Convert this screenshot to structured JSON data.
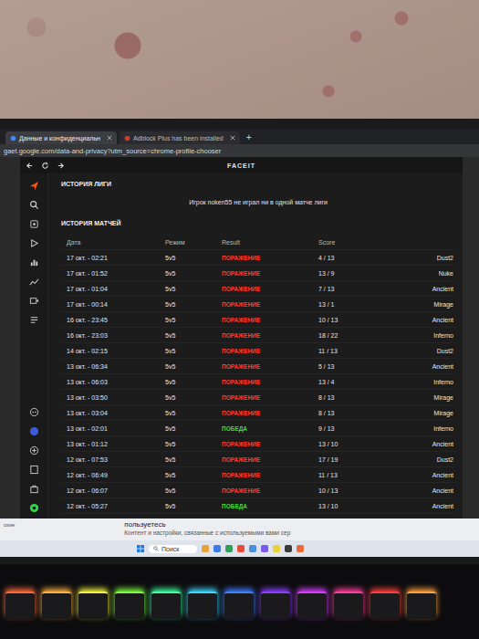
{
  "browser": {
    "tabs": [
      {
        "label": "Данные и конфиденциальн",
        "selected": true
      },
      {
        "label": "Adblock Plus has been installed",
        "selected": false
      }
    ],
    "new_tab": "+",
    "address": "gaet.google.com/data-and-privacy?utm_source=chrome-profile-chooser"
  },
  "app": {
    "title": "FACEIT",
    "league": {
      "title": "ИСТОРИЯ ЛИГИ",
      "message": "Игрок noken55 не играл ни в одной матче лиги"
    },
    "matches": {
      "title": "ИСТОРИЯ МАТЧЕЙ",
      "columns": [
        "Дата",
        "Режим",
        "Result",
        "Score"
      ],
      "rows": [
        {
          "date": "17 окт. - 02:21",
          "mode": "5v5",
          "result": "ПОРАЖЕНИЕ",
          "won": false,
          "score": "4 / 13",
          "map": "Dust2"
        },
        {
          "date": "17 окт. - 01:52",
          "mode": "5v5",
          "result": "ПОРАЖЕНИЕ",
          "won": false,
          "score": "13 / 9",
          "map": "Nuke"
        },
        {
          "date": "17 окт. - 01:04",
          "mode": "5v5",
          "result": "ПОРАЖЕНИЕ",
          "won": false,
          "score": "7 / 13",
          "map": "Ancient"
        },
        {
          "date": "17 окт. - 00:14",
          "mode": "5v5",
          "result": "ПОРАЖЕНИЕ",
          "won": false,
          "score": "13 / 1",
          "map": "Mirage"
        },
        {
          "date": "16 окт. - 23:45",
          "mode": "5v5",
          "result": "ПОРАЖЕНИЕ",
          "won": false,
          "score": "10 / 13",
          "map": "Ancient"
        },
        {
          "date": "16 окт. - 23:03",
          "mode": "5v5",
          "result": "ПОРАЖЕНИЕ",
          "won": false,
          "score": "18 / 22",
          "map": "Inferno"
        },
        {
          "date": "14 окт. - 02:15",
          "mode": "5v5",
          "result": "ПОРАЖЕНИЕ",
          "won": false,
          "score": "11 / 13",
          "map": "Dust2"
        },
        {
          "date": "13 окт. - 06:34",
          "mode": "5v5",
          "result": "ПОРАЖЕНИЕ",
          "won": false,
          "score": "5 / 13",
          "map": "Ancient"
        },
        {
          "date": "13 окт. - 06:03",
          "mode": "5v5",
          "result": "ПОРАЖЕНИЕ",
          "won": false,
          "score": "13 / 4",
          "map": "Inferno"
        },
        {
          "date": "13 окт. - 03:50",
          "mode": "5v5",
          "result": "ПОРАЖЕНИЕ",
          "won": false,
          "score": "8 / 13",
          "map": "Mirage"
        },
        {
          "date": "13 окт. - 03:04",
          "mode": "5v5",
          "result": "ПОРАЖЕНИЕ",
          "won": false,
          "score": "8 / 13",
          "map": "Mirage"
        },
        {
          "date": "13 окт. - 02:01",
          "mode": "5v5",
          "result": "ПОБЕДА",
          "won": true,
          "score": "9 / 13",
          "map": "Inferno"
        },
        {
          "date": "13 окт. - 01:12",
          "mode": "5v5",
          "result": "ПОРАЖЕНИЕ",
          "won": false,
          "score": "13 / 10",
          "map": "Ancient"
        },
        {
          "date": "12 окт. - 07:53",
          "mode": "5v5",
          "result": "ПОРАЖЕНИЕ",
          "won": false,
          "score": "17 / 19",
          "map": "Dust2"
        },
        {
          "date": "12 окт. - 06:49",
          "mode": "5v5",
          "result": "ПОРАЖЕНИЕ",
          "won": false,
          "score": "11 / 13",
          "map": "Ancient"
        },
        {
          "date": "12 окт. - 06:07",
          "mode": "5v5",
          "result": "ПОРАЖЕНИЕ",
          "won": false,
          "score": "10 / 13",
          "map": "Ancient"
        },
        {
          "date": "12 окт. - 05:27",
          "mode": "5v5",
          "result": "ПОБЕДА",
          "won": true,
          "score": "13 / 10",
          "map": "Ancient"
        }
      ]
    }
  },
  "page": {
    "side_text": "ские",
    "heading": "пользуетесь",
    "text": "Контент и настройки, связанные с используемыми вами сер"
  },
  "taskbar": {
    "search": "Поиск"
  }
}
